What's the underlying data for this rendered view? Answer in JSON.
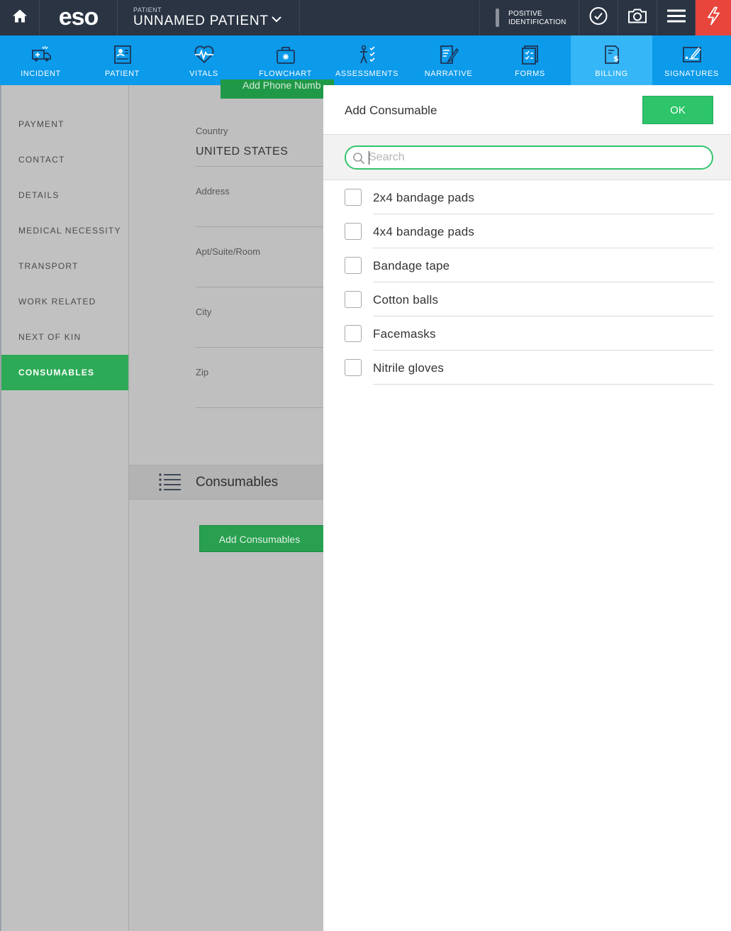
{
  "header": {
    "logo": "eso",
    "patient_label": "PATIENT",
    "patient_name": "UNNAMED PATIENT",
    "positive_id_line1": "POSITIVE",
    "positive_id_line2": "IDENTIFICATION",
    "flash_color": "#e8453c"
  },
  "nav": {
    "items": [
      {
        "label": "INCIDENT",
        "icon": "ambulance-icon"
      },
      {
        "label": "PATIENT",
        "icon": "patient-card-icon"
      },
      {
        "label": "VITALS",
        "icon": "heartbeat-icon"
      },
      {
        "label": "FLOWCHART",
        "icon": "medical-bag-icon"
      },
      {
        "label": "ASSESSMENTS",
        "icon": "body-checklist-icon"
      },
      {
        "label": "NARRATIVE",
        "icon": "document-pen-icon"
      },
      {
        "label": "FORMS",
        "icon": "forms-checklist-icon"
      },
      {
        "label": "BILLING",
        "icon": "billing-dollar-icon"
      },
      {
        "label": "SIGNATURES",
        "icon": "signature-icon"
      }
    ],
    "active": "BILLING",
    "color": "#0c9aea"
  },
  "sidenav": {
    "items": [
      "PAYMENT",
      "CONTACT",
      "DETAILS",
      "MEDICAL NECESSITY",
      "TRANSPORT",
      "WORK RELATED",
      "NEXT OF KIN",
      "CONSUMABLES"
    ],
    "active": "CONSUMABLES"
  },
  "form": {
    "add_phone_label": "Add Phone Numb",
    "country_label": "Country",
    "country_value": "UNITED STATES",
    "address_label": "Address",
    "apt_label": "Apt/Suite/Room",
    "city_label": "City",
    "zip_label": "Zip",
    "consumables_title": "Consumables",
    "add_consumables_label": "Add Consumables"
  },
  "dialog": {
    "title": "Add Consumable",
    "ok_label": "OK",
    "search_placeholder": "Search",
    "search_value": "",
    "items": [
      {
        "label": "2x4 bandage pads",
        "checked": false
      },
      {
        "label": "4x4 bandage pads",
        "checked": false
      },
      {
        "label": "Bandage tape",
        "checked": false
      },
      {
        "label": "Cotton balls",
        "checked": false
      },
      {
        "label": "Facemasks",
        "checked": false
      },
      {
        "label": "Nitrile gloves",
        "checked": false
      }
    ]
  }
}
